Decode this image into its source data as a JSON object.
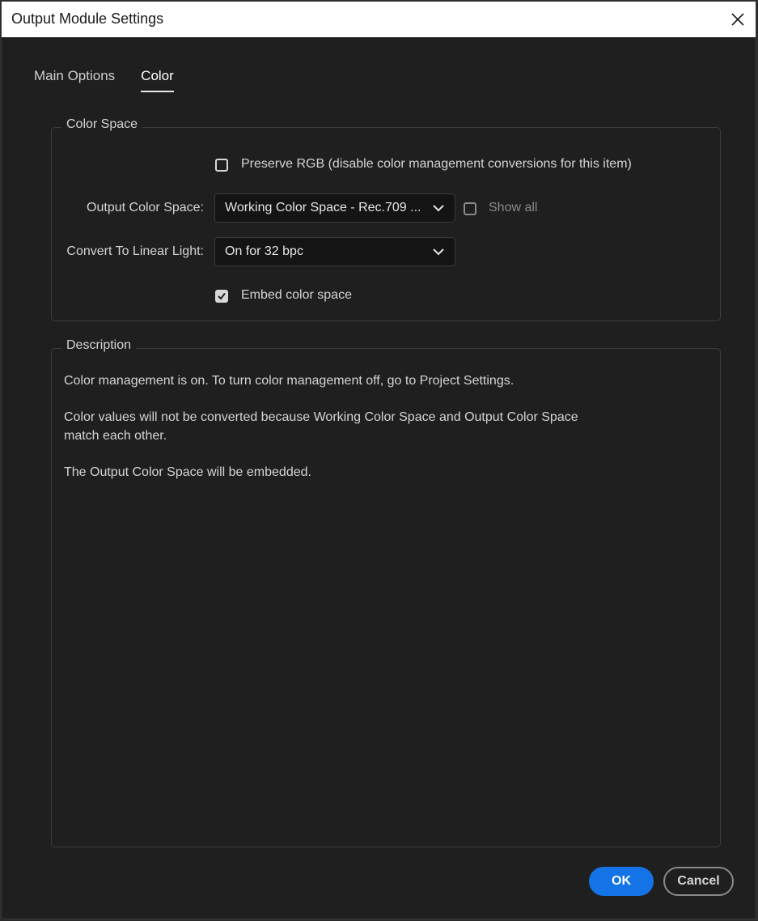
{
  "window": {
    "title": "Output Module Settings"
  },
  "tabs": [
    {
      "label": "Main Options",
      "active": false
    },
    {
      "label": "Color",
      "active": true
    }
  ],
  "color_space": {
    "group_label": "Color Space",
    "preserve_rgb": {
      "label": "Preserve RGB (disable color management conversions for this item)",
      "checked": false
    },
    "output_color_space": {
      "label": "Output Color Space:",
      "value": "Working Color Space - Rec.709 ..."
    },
    "show_all": {
      "label": "Show all",
      "checked": false
    },
    "convert_linear": {
      "label": "Convert To Linear Light:",
      "value": "On for 32 bpc"
    },
    "embed": {
      "label": "Embed color space",
      "checked": true
    }
  },
  "description": {
    "group_label": "Description",
    "lines": [
      "Color management is on. To turn color management off, go to Project Settings.",
      "Color values will not be converted because Working Color Space and Output Color Space match each other.",
      "The Output Color Space will be embedded."
    ]
  },
  "buttons": {
    "ok": "OK",
    "cancel": "Cancel"
  },
  "colors": {
    "accent": "#1473e6",
    "background": "#1f1f1f",
    "dropdown_bg": "#141414"
  },
  "icons": {
    "close": "close-icon",
    "chevron": "chevron-down-icon",
    "check": "check-icon"
  }
}
